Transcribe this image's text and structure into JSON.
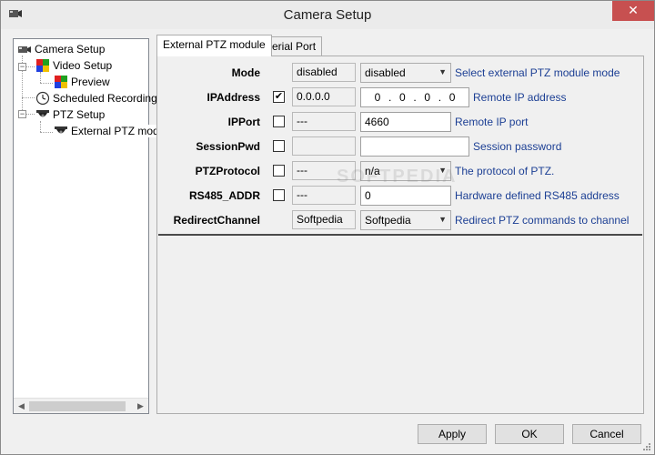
{
  "window": {
    "title": "Camera Setup",
    "close_glyph": "✕"
  },
  "tree": {
    "items": [
      {
        "label": "Camera Setup",
        "icon": "camera-icon"
      },
      {
        "label": "Video Setup",
        "icon": "video-setup-icon"
      },
      {
        "label": "Preview",
        "icon": "preview-icon"
      },
      {
        "label": "Scheduled Recording",
        "icon": "clock-icon"
      },
      {
        "label": "PTZ Setup",
        "icon": "dome-camera-icon"
      },
      {
        "label": "External PTZ mod",
        "icon": "dome-camera-icon"
      }
    ],
    "scroll_left": "◀",
    "scroll_right": "▶"
  },
  "tabs": [
    {
      "label": "External PTZ module",
      "active": true
    },
    {
      "label": "Serial Port",
      "active": false
    }
  ],
  "form": {
    "rows": [
      {
        "label": "Mode",
        "checked": null,
        "current": "disabled",
        "control": "select",
        "value": "disabled",
        "desc": "Select external PTZ module mode"
      },
      {
        "label": "IPAddress",
        "checked": true,
        "current": "0.0.0.0",
        "control": "ip",
        "value": [
          "0",
          "0",
          "0",
          "0"
        ],
        "desc": "Remote IP address"
      },
      {
        "label": "IPPort",
        "checked": false,
        "current": "---",
        "control": "input",
        "value": "4660",
        "desc": "Remote IP port"
      },
      {
        "label": "SessionPwd",
        "checked": false,
        "current": "",
        "control": "input",
        "value": "",
        "desc": "Session password"
      },
      {
        "label": "PTZProtocol",
        "checked": false,
        "current": "---",
        "control": "select",
        "value": "n/a",
        "desc": "The protocol of PTZ."
      },
      {
        "label": "RS485_ADDR",
        "checked": false,
        "current": "---",
        "control": "input",
        "value": "0",
        "desc": "Hardware defined RS485 address"
      },
      {
        "label": "RedirectChannel",
        "checked": null,
        "current": "Softpedia",
        "control": "select",
        "value": "Softpedia",
        "desc": "Redirect PTZ commands to channel"
      }
    ],
    "check_glyph": "✔",
    "caret_glyph": "▼"
  },
  "watermark": "SOFTPEDIA",
  "buttons": {
    "apply": "Apply",
    "ok": "OK",
    "cancel": "Cancel"
  },
  "colors": {
    "desc_text": "#1c3f94",
    "close_bg": "#c75050"
  }
}
